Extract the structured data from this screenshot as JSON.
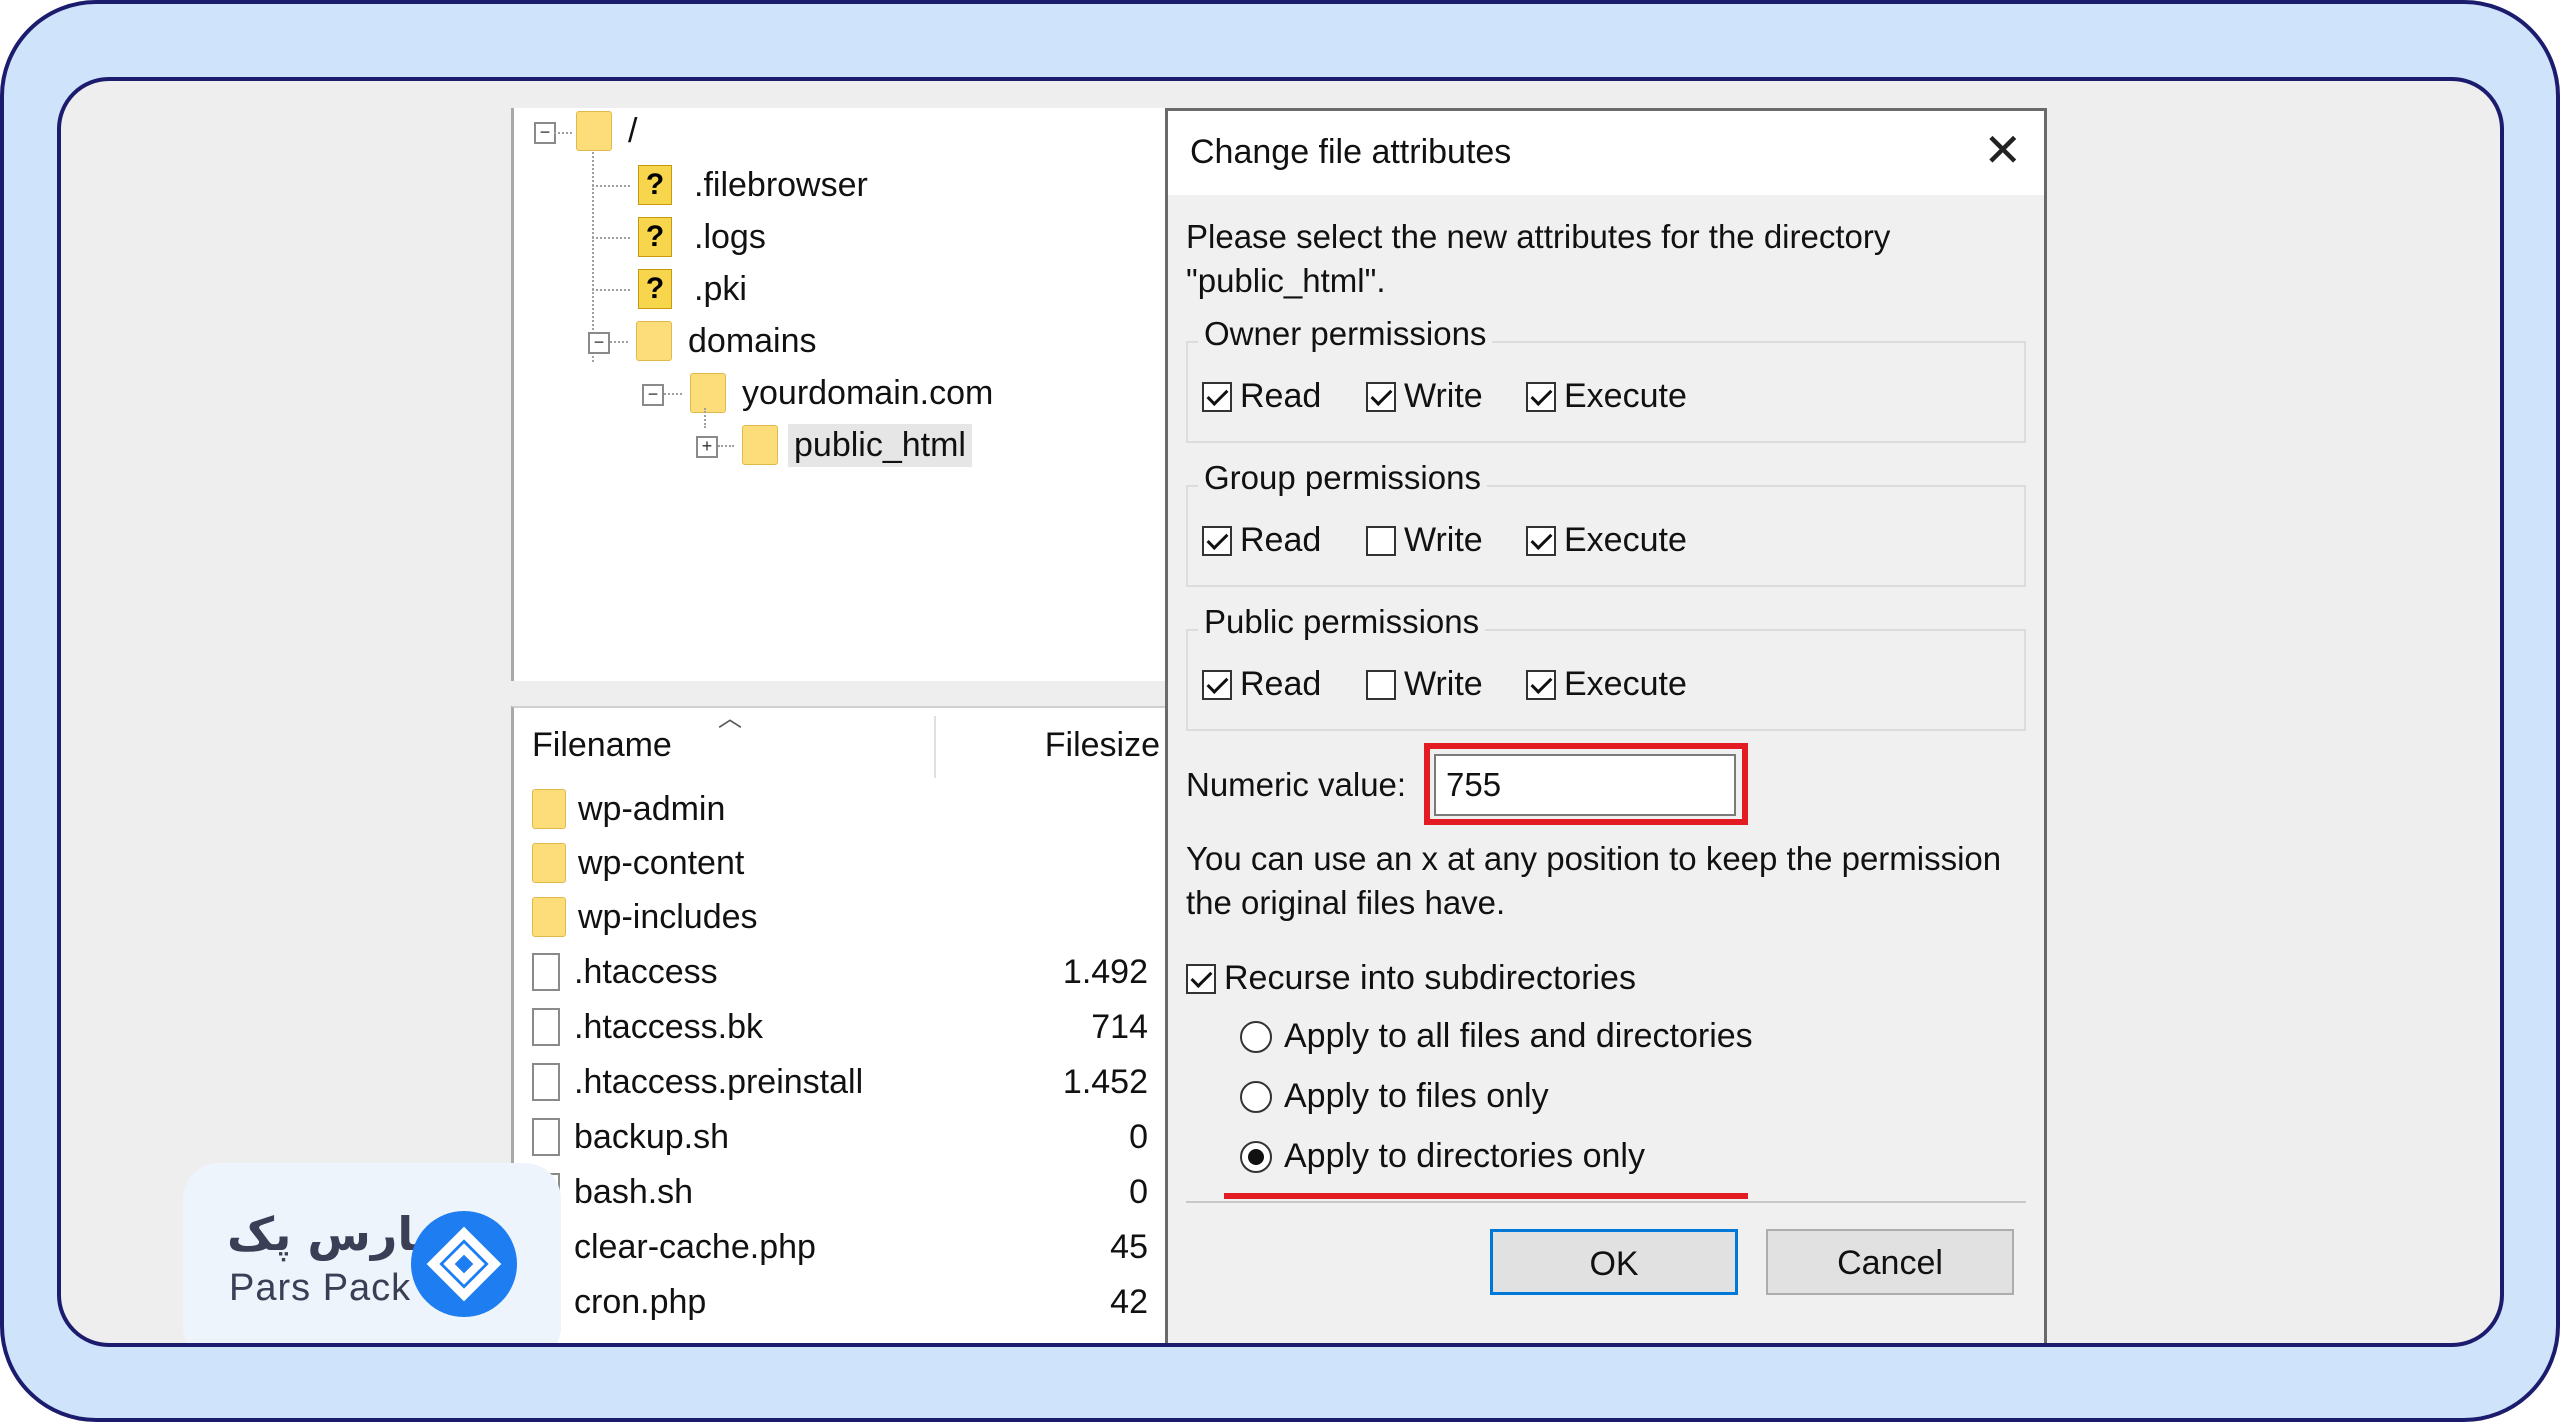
{
  "tree": {
    "root": "/",
    "items": [
      ".filebrowser",
      ".logs",
      ".pki",
      "domains",
      "yourdomain.com",
      "public_html"
    ]
  },
  "file_list": {
    "columns": [
      "Filename",
      "Filesize"
    ],
    "rows": [
      {
        "name": "wp-admin",
        "size": "",
        "type": "folder"
      },
      {
        "name": "wp-content",
        "size": "",
        "type": "folder"
      },
      {
        "name": "wp-includes",
        "size": "",
        "type": "folder"
      },
      {
        "name": ".htaccess",
        "size": "1.492",
        "type": "file"
      },
      {
        "name": ".htaccess.bk",
        "size": "714",
        "type": "file"
      },
      {
        "name": ".htaccess.preinstall",
        "size": "1.452",
        "type": "file"
      },
      {
        "name": "backup.sh",
        "size": "0",
        "type": "file"
      },
      {
        "name": "bash.sh",
        "size": "0",
        "type": "file"
      },
      {
        "name": "clear-cache.php",
        "size": "45",
        "type": "file"
      },
      {
        "name": "cron.php",
        "size": "42",
        "type": "file"
      }
    ]
  },
  "dialog": {
    "title": "Change file attributes",
    "prompt_line1": "Please select the new attributes for the directory",
    "prompt_line2": "\"public_html\".",
    "groups": {
      "owner": {
        "title": "Owner permissions",
        "read": true,
        "write": true,
        "execute": true
      },
      "group": {
        "title": "Group permissions",
        "read": true,
        "write": false,
        "execute": true
      },
      "public": {
        "title": "Public permissions",
        "read": true,
        "write": false,
        "execute": true
      }
    },
    "labels": {
      "read": "Read",
      "write": "Write",
      "execute": "Execute"
    },
    "numeric_label": "Numeric value:",
    "numeric_value": "755",
    "hint_line1": "You can use an x at any position to keep the permission",
    "hint_line2": "the original files have.",
    "recurse_label": "Recurse into subdirectories",
    "recurse_checked": true,
    "radio_options": [
      "Apply to all files and directories",
      "Apply to files only",
      "Apply to directories only"
    ],
    "radio_selected": 2,
    "ok_label": "OK",
    "cancel_label": "Cancel"
  },
  "logo": {
    "text_fa": "پارس پک",
    "text_en": "Pars Pack"
  },
  "colors": {
    "highlight": "#e31b23",
    "frame_bg": "#cfe3fb",
    "frame_border": "#1c1c6e",
    "logo_blue": "#1e7df0"
  }
}
